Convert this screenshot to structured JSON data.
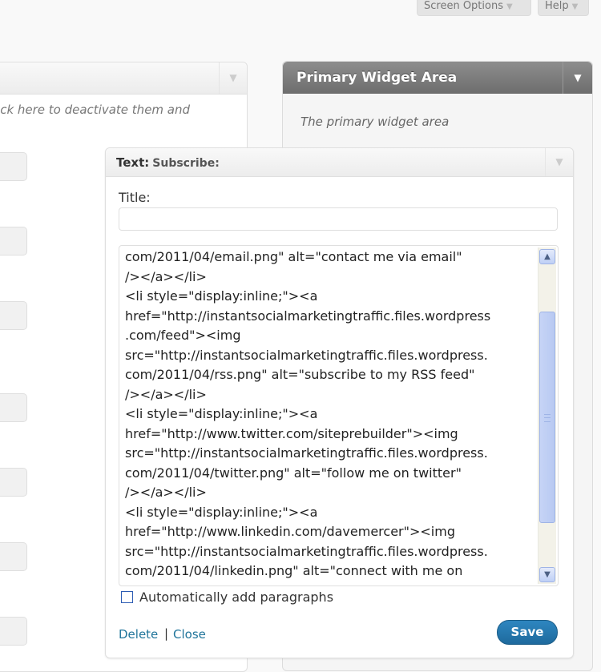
{
  "screen_meta": {
    "screen_options_label": "Screen Options",
    "help_label": "Help",
    "arrow": "▼"
  },
  "available_panel": {
    "description": "ack here to deactivate them and"
  },
  "sidebar": {
    "title": "Primary Widget Area",
    "toggle": "▼",
    "description": "The primary widget area"
  },
  "widget": {
    "type": "Text:",
    "subtitle": "Subscribe:",
    "toggle": "▼",
    "title_label": "Title:",
    "title_value": "",
    "text_lines": [
      "com/2011/04/email.png\" alt=\"contact me via email\"",
      "/></a></li>",
      "<li style=\"display:inline;\"><a",
      "href=\"http://instantsocialmarketingtraffic.files.wordpress",
      ".com/feed\"><img",
      "src=\"http://instantsocialmarketingtraffic.files.wordpress.",
      "com/2011/04/rss.png\" alt=\"subscribe to my RSS feed\"",
      "/></a></li>",
      "<li style=\"display:inline;\"><a",
      "href=\"http://www.twitter.com/siteprebuilder\"><img",
      "src=\"http://instantsocialmarketingtraffic.files.wordpress.",
      "com/2011/04/twitter.png\" alt=\"follow me on twitter\"",
      "/></a></li>",
      "<li style=\"display:inline;\"><a",
      "href=\"http://www.linkedin.com/davemercer\"><img",
      "src=\"http://instantsocialmarketingtraffic.files.wordpress.",
      "com/2011/04/linkedin.png\" alt=\"connect with me on"
    ],
    "autop_label": "Automatically add paragraphs",
    "autop_checked": false,
    "delete_label": "Delete",
    "separator": "|",
    "close_label": "Close",
    "save_label": "Save"
  },
  "colors": {
    "link": "#21759b",
    "save_button": "#21759b",
    "sidebar_header": "#7a7a7a"
  }
}
